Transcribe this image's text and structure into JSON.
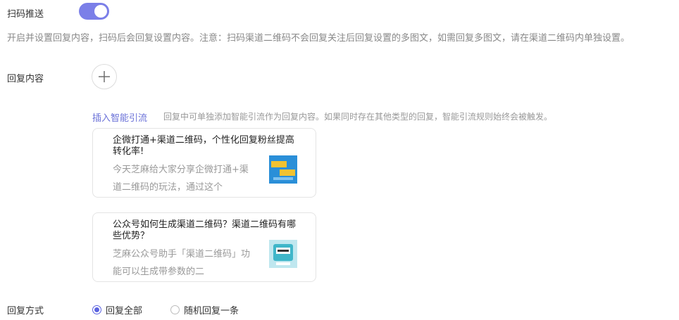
{
  "scan_push": {
    "label": "扫码推送",
    "enabled": true,
    "hint": "开启并设置回复内容，扫码后会回复设置内容。注意：扫码渠道二维码不会回复关注后回复设置的多图文，如需回复多图文，请在渠道二维码内单独设置。"
  },
  "reply_content": {
    "label": "回复内容",
    "add_icon": "plus-icon"
  },
  "smart_flow": {
    "link_label": "插入智能引流",
    "hint": "回复中可单独添加智能引流作为回复内容。如果同时存在其他类型的回复，智能引流规则始终会被触发。"
  },
  "cards": [
    {
      "title": "企微打通+渠道二维码，个性化回复粉丝提高转化率!",
      "desc": "今天芝麻给大家分享企微打通+渠道二维码的玩法，通过这个",
      "thumb_colors": [
        "#2a8fd8",
        "#f2c230"
      ]
    },
    {
      "title": "公众号如何生成渠道二维码？渠道二维码有哪些优势？",
      "desc": "芝麻公众号助手「渠道二维码」功能可以生成带参数的二",
      "thumb_colors": [
        "#bfe7ef",
        "#3fb6c9"
      ]
    }
  ],
  "reply_mode": {
    "label": "回复方式",
    "options": [
      {
        "label": "回复全部",
        "checked": true
      },
      {
        "label": "随机回复一条",
        "checked": false
      }
    ]
  },
  "colors": {
    "accent": "#5b63e0",
    "toggle": "#7b7fe8",
    "link": "#6b72d8"
  }
}
